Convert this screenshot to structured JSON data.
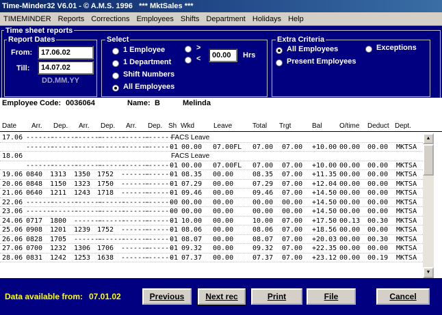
{
  "window": {
    "title": "Time-Minder32 V6.01 - © A.M.S. 1996   *** MktSales ***"
  },
  "menu": [
    "TIMEMINDER",
    "Reports",
    "Corrections",
    "Employees",
    "Shifts",
    "Department",
    "Holidays",
    "Help"
  ],
  "panel_title": "Time sheet reports",
  "report_dates": {
    "title": "Report Dates",
    "from_label": "From:",
    "from_value": "17.06.02",
    "till_label": "Till:",
    "till_value": "14.07.02",
    "format_hint": "DD.MM.YY"
  },
  "select": {
    "title": "Select",
    "options": [
      "1 Employee",
      "1 Department",
      "Shift Numbers",
      "All Employees"
    ],
    "selected": "All Employees",
    "gt_label": ">",
    "lt_label": "<",
    "hours_value": "00.00",
    "hours_unit": "Hrs"
  },
  "extra_criteria": {
    "title": "Extra Criteria",
    "options": [
      "All Employees",
      "Present Employees",
      "Exceptions"
    ],
    "selected": "All Employees"
  },
  "employee": {
    "code_label": "Employee Code:",
    "code_value": "0036064",
    "name_label": "Name:",
    "initial": "B",
    "first_name": "Melinda"
  },
  "table": {
    "columns": [
      "Date",
      "Arr.",
      "Dep.",
      "Arr.",
      "Dep.",
      "Arr.",
      "Dep.",
      "Sh",
      "Wkd",
      "Leave",
      "Total",
      "Trgt",
      "Bal",
      "O/time",
      "Deduct",
      "Dept."
    ],
    "rows": [
      {
        "date": "17.06",
        "a1": "-------",
        "d1": "-------",
        "a2": "-------",
        "d2": "-------",
        "a3": "-------",
        "d3": "-------",
        "leave_title": "FACS Leave"
      },
      {
        "date": "",
        "a1": "-------",
        "d1": "-------",
        "a2": "-------",
        "d2": "-------",
        "a3": "-------",
        "d3": "-------",
        "sh": "01",
        "wkd": "00.00",
        "leave": "07.00FL",
        "total": "07.00",
        "trgt": "07.00",
        "bal": "+10.00",
        "ot": "00.00",
        "ded": "00.00",
        "dept": "MKTSA"
      },
      {
        "date": "18.06",
        "a1": "",
        "d1": "",
        "a2": "",
        "d2": "",
        "a3": "",
        "d3": "",
        "leave_title": "FACS Leave"
      },
      {
        "date": "",
        "a1": "-------",
        "d1": "-------",
        "a2": "-------",
        "d2": "-------",
        "a3": "-------",
        "d3": "-------",
        "sh": "01",
        "wkd": "00.00",
        "leave": "07.00FL",
        "total": "07.00",
        "trgt": "07.00",
        "bal": "+10.00",
        "ot": "00.00",
        "ded": "00.00",
        "dept": "MKTSA"
      },
      {
        "date": "19.06",
        "a1": "0840",
        "d1": "1313",
        "a2": "1350",
        "d2": "1752",
        "a3": "-------",
        "d3": "-------",
        "sh": "01",
        "wkd": "08.35",
        "leave": "00.00",
        "total": "08.35",
        "trgt": "07.00",
        "bal": "+11.35",
        "ot": "00.00",
        "ded": "00.00",
        "dept": "MKTSA"
      },
      {
        "date": "20.06",
        "a1": "0848",
        "d1": "1150",
        "a2": "1323",
        "d2": "1750",
        "a3": "-------",
        "d3": "-------",
        "sh": "01",
        "wkd": "07.29",
        "leave": "00.00",
        "total": "07.29",
        "trgt": "07.00",
        "bal": "+12.04",
        "ot": "00.00",
        "ded": "00.00",
        "dept": "MKTSA"
      },
      {
        "date": "21.06",
        "a1": "0640",
        "d1": "1211",
        "a2": "1243",
        "d2": "1718",
        "a3": "-------",
        "d3": "-------",
        "sh": "01",
        "wkd": "09.46",
        "leave": "00.00",
        "total": "09.46",
        "trgt": "07.00",
        "bal": "+14.50",
        "ot": "00.00",
        "ded": "00.00",
        "dept": "MKTSA"
      },
      {
        "date": "22.06",
        "a1": "-------",
        "d1": "-------",
        "a2": "-------",
        "d2": "-------",
        "a3": "-------",
        "d3": "-------",
        "sh": "00",
        "wkd": "00.00",
        "leave": "00.00",
        "total": "00.00",
        "trgt": "00.00",
        "bal": "+14.50",
        "ot": "00.00",
        "ded": "00.00",
        "dept": "MKTSA"
      },
      {
        "date": "23.06",
        "a1": "-------",
        "d1": "-------",
        "a2": "-------",
        "d2": "-------",
        "a3": "-------",
        "d3": "-------",
        "sh": "00",
        "wkd": "00.00",
        "leave": "00.00",
        "total": "00.00",
        "trgt": "00.00",
        "bal": "+14.50",
        "ot": "00.00",
        "ded": "00.00",
        "dept": "MKTSA"
      },
      {
        "date": "24.06",
        "a1": "0717",
        "d1": "1800",
        "a2": "-------",
        "d2": "-------",
        "a3": "-------",
        "d3": "-------",
        "sh": "01",
        "wkd": "10.00",
        "leave": "00.00",
        "total": "10.00",
        "trgt": "07.00",
        "bal": "+17.50",
        "ot": "00.13",
        "ded": "00.30",
        "dept": "MKTSA"
      },
      {
        "date": "25.06",
        "a1": "0908",
        "d1": "1201",
        "a2": "1239",
        "d2": "1752",
        "a3": "-------",
        "d3": "-------",
        "sh": "01",
        "wkd": "08.06",
        "leave": "00.00",
        "total": "08.06",
        "trgt": "07.00",
        "bal": "+18.56",
        "ot": "00.00",
        "ded": "00.00",
        "dept": "MKTSA"
      },
      {
        "date": "26.06",
        "a1": "0828",
        "d1": "1705",
        "a2": "-------",
        "d2": "-------",
        "a3": "-------",
        "d3": "-------",
        "sh": "01",
        "wkd": "08.07",
        "leave": "00.00",
        "total": "08.07",
        "trgt": "07.00",
        "bal": "+20.03",
        "ot": "00.00",
        "ded": "00.30",
        "dept": "MKTSA"
      },
      {
        "date": "27.06",
        "a1": "0700",
        "d1": "1232",
        "a2": "1306",
        "d2": "1706",
        "a3": "-------",
        "d3": "-------",
        "sh": "01",
        "wkd": "09.32",
        "leave": "00.00",
        "total": "09.32",
        "trgt": "07.00",
        "bal": "+22.35",
        "ot": "00.00",
        "ded": "00.00",
        "dept": "MKTSA"
      },
      {
        "date": "28.06",
        "a1": "0831",
        "d1": "1242",
        "a2": "1253",
        "d2": "1638",
        "a3": "-------",
        "d3": "-------",
        "sh": "01",
        "wkd": "07.37",
        "leave": "00.00",
        "total": "07.37",
        "trgt": "07.00",
        "bal": "+23.12",
        "ot": "00.00",
        "ded": "00.19",
        "dept": "MKTSA"
      }
    ]
  },
  "footer": {
    "available_label": "Data available from:",
    "available_date": "07.01.02",
    "buttons": [
      "Previous",
      "Next rec",
      "Print",
      "File",
      "Cancel"
    ]
  },
  "colors": {
    "panel": "#000080",
    "title_gradient_start": "#0a246a",
    "highlight_text": "#ffff00"
  }
}
